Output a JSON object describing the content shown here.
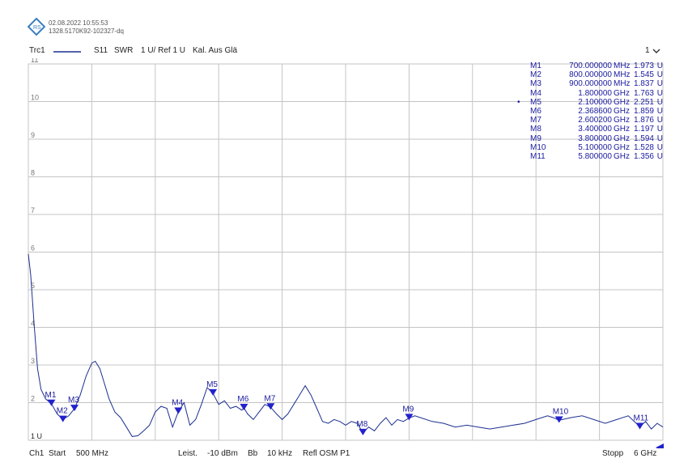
{
  "header": {
    "date": "02.08.2022 10:55:53",
    "serial": "1328.5170K92-102327-dq",
    "logo_icon": "rohde-schwarz-logo-icon"
  },
  "trace_bar": {
    "trace": "Trc1",
    "param": "S11",
    "format": "SWR",
    "scale": "1 U/ Ref 1 U",
    "cal": "Kal. Aus Glä",
    "channel_select": "1"
  },
  "footer": {
    "channel": "Ch1",
    "start_label": "Start",
    "start_value": "500 MHz",
    "power_label": "Leist.",
    "power_value": "-10 dBm",
    "bw_label": "Bb",
    "bw_value": "10 kHz",
    "port": "Refl OSM P1",
    "stop_label": "Stopp",
    "stop_value": "6 GHz"
  },
  "colors": {
    "trace": "#1c2f8f",
    "marker": "#2222cc",
    "grid": "#c4c4c4",
    "text": "#1a1aa0"
  },
  "markers": [
    {
      "name": "M1",
      "freq": "700.000000",
      "unit": "MHz",
      "swr": "1.973",
      "swr_unit": "U",
      "active": false
    },
    {
      "name": "M2",
      "freq": "800.000000",
      "unit": "MHz",
      "swr": "1.545",
      "swr_unit": "U",
      "active": false
    },
    {
      "name": "M3",
      "freq": "900.000000",
      "unit": "MHz",
      "swr": "1.837",
      "swr_unit": "U",
      "active": false
    },
    {
      "name": "M4",
      "freq": "1.800000",
      "unit": "GHz",
      "swr": "1.763",
      "swr_unit": "U",
      "active": false
    },
    {
      "name": "M5",
      "freq": "2.100000",
      "unit": "GHz",
      "swr": "2.251",
      "swr_unit": "U",
      "active": true
    },
    {
      "name": "M6",
      "freq": "2.368600",
      "unit": "GHz",
      "swr": "1.859",
      "swr_unit": "U",
      "active": false
    },
    {
      "name": "M7",
      "freq": "2.600200",
      "unit": "GHz",
      "swr": "1.876",
      "swr_unit": "U",
      "active": false
    },
    {
      "name": "M8",
      "freq": "3.400000",
      "unit": "GHz",
      "swr": "1.197",
      "swr_unit": "U",
      "active": false
    },
    {
      "name": "M9",
      "freq": "3.800000",
      "unit": "GHz",
      "swr": "1.594",
      "swr_unit": "U",
      "active": false
    },
    {
      "name": "M10",
      "freq": "5.100000",
      "unit": "GHz",
      "swr": "1.528",
      "swr_unit": "U",
      "active": false
    },
    {
      "name": "M11",
      "freq": "5.800000",
      "unit": "GHz",
      "swr": "1.356",
      "swr_unit": "U",
      "active": false
    }
  ],
  "chart_data": {
    "type": "line",
    "title": "",
    "xlabel": "",
    "ylabel": "",
    "x_unit": "GHz",
    "xlim": [
      0.5,
      6.0
    ],
    "ylim": [
      1,
      11
    ],
    "y_ticks": [
      "1 U",
      "2",
      "3",
      "4",
      "5",
      "6",
      "7",
      "8",
      "9",
      "10",
      "11"
    ],
    "grid": true,
    "series": [
      {
        "x": [
          0.5,
          0.52,
          0.55,
          0.58,
          0.61,
          0.65,
          0.7,
          0.75,
          0.8,
          0.85,
          0.9,
          0.95,
          1.0,
          1.05,
          1.08,
          1.12,
          1.15,
          1.2,
          1.25,
          1.3,
          1.35,
          1.4,
          1.45,
          1.5,
          1.55,
          1.6,
          1.65,
          1.7,
          1.75,
          1.8,
          1.85,
          1.9,
          1.95,
          2.0,
          2.05,
          2.1,
          2.15,
          2.2,
          2.25,
          2.3,
          2.35,
          2.3686,
          2.4,
          2.45,
          2.5,
          2.55,
          2.6,
          2.65,
          2.7,
          2.75,
          2.8,
          2.85,
          2.9,
          2.95,
          3.0,
          3.05,
          3.1,
          3.15,
          3.2,
          3.25,
          3.3,
          3.35,
          3.4,
          3.45,
          3.5,
          3.55,
          3.6,
          3.65,
          3.7,
          3.75,
          3.8,
          3.85,
          3.9,
          4.0,
          4.1,
          4.2,
          4.3,
          4.4,
          4.5,
          4.6,
          4.7,
          4.8,
          4.9,
          5.0,
          5.05,
          5.1,
          5.2,
          5.3,
          5.4,
          5.5,
          5.6,
          5.7,
          5.8,
          5.85,
          5.9,
          5.95,
          6.0
        ],
        "y": [
          5.95,
          5.4,
          4.1,
          2.9,
          2.35,
          2.1,
          1.97,
          1.7,
          1.55,
          1.65,
          1.84,
          2.2,
          2.7,
          3.05,
          3.1,
          2.9,
          2.6,
          2.1,
          1.75,
          1.6,
          1.35,
          1.1,
          1.12,
          1.25,
          1.4,
          1.75,
          1.9,
          1.85,
          1.35,
          1.76,
          2.0,
          1.4,
          1.55,
          1.95,
          2.4,
          2.25,
          1.95,
          2.05,
          1.85,
          1.9,
          1.8,
          1.86,
          1.7,
          1.55,
          1.75,
          1.95,
          1.88,
          1.7,
          1.55,
          1.7,
          1.95,
          2.2,
          2.45,
          2.2,
          1.85,
          1.5,
          1.45,
          1.55,
          1.5,
          1.4,
          1.5,
          1.45,
          1.2,
          1.35,
          1.25,
          1.45,
          1.6,
          1.4,
          1.55,
          1.5,
          1.59,
          1.65,
          1.6,
          1.5,
          1.45,
          1.35,
          1.4,
          1.35,
          1.3,
          1.35,
          1.4,
          1.45,
          1.55,
          1.65,
          1.6,
          1.53,
          1.6,
          1.65,
          1.55,
          1.45,
          1.55,
          1.65,
          1.36,
          1.5,
          1.3,
          1.45,
          1.35
        ]
      }
    ]
  }
}
